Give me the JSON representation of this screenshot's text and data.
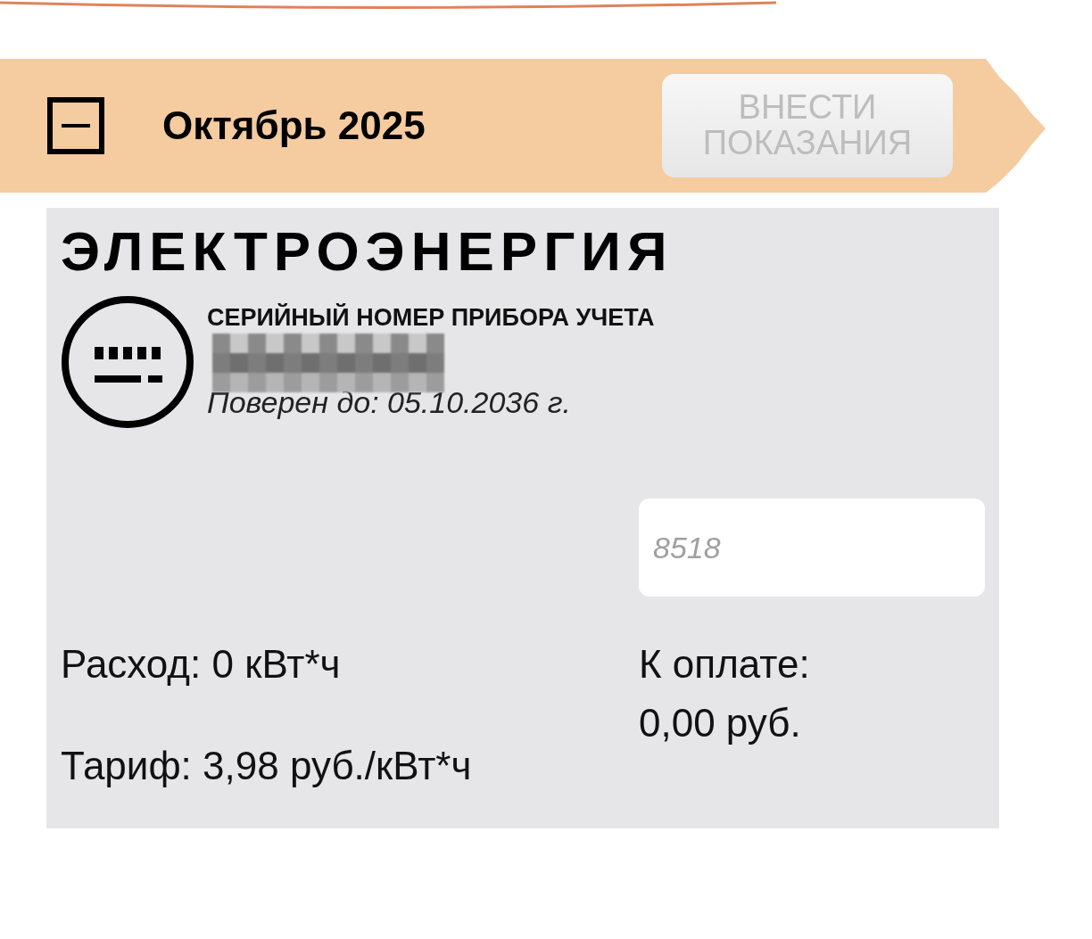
{
  "period": {
    "title": "Октябрь 2025",
    "expanded": true
  },
  "submit_button": {
    "label": "ВНЕСТИ ПОКАЗАНИЯ",
    "disabled": true
  },
  "meter": {
    "title": "ЭЛЕКТРОЭНЕРГИЯ",
    "serial_label": "СЕРИЙНЫЙ НОМЕР ПРИБОРА УЧЕТА",
    "serial_redacted": true,
    "verified_until": "Поверен до: 05.10.2036 г.",
    "reading_field": {
      "placeholder": "8518"
    },
    "consumption": "Расход: 0 кВт*ч",
    "tariff": "Тариф: 3,98 руб./кВт*ч",
    "due_label": "К оплате:",
    "due_amount": "0,00 руб."
  }
}
